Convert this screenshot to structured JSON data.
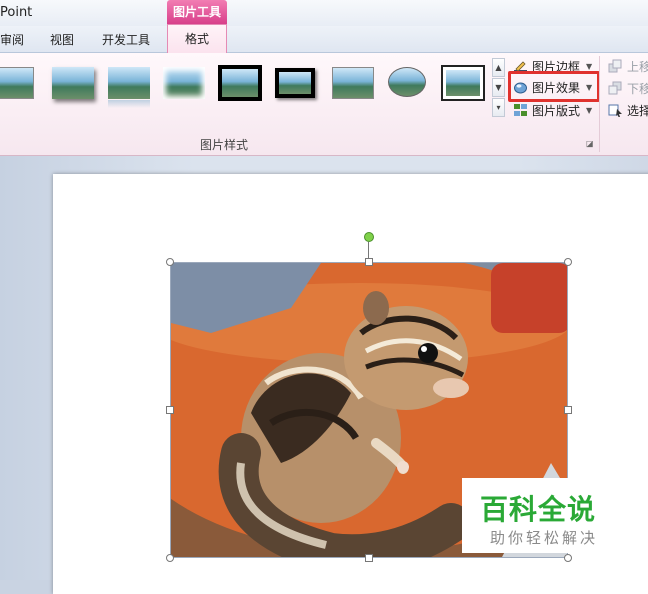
{
  "window": {
    "title_fragment": "Point"
  },
  "tabs": [
    {
      "label": "审阅"
    },
    {
      "label": "视图"
    },
    {
      "label": "开发工具"
    }
  ],
  "contextual_tab": {
    "header": "图片工具",
    "active_tab": "格式"
  },
  "ribbon": {
    "gallery_group_label": "图片样式",
    "commands": {
      "picture_border": "图片边框",
      "picture_effects": "图片效果",
      "picture_layout": "图片版式",
      "bring_forward": "上移",
      "send_backward": "下移",
      "selection_pane": "选择"
    }
  },
  "watermark": {
    "line1": "百科全说",
    "line2": "助你轻松解决"
  },
  "colors": {
    "contextual_pink": "#d83f8a",
    "highlight_red": "#e0322e",
    "watermark_green": "#2aa936"
  }
}
